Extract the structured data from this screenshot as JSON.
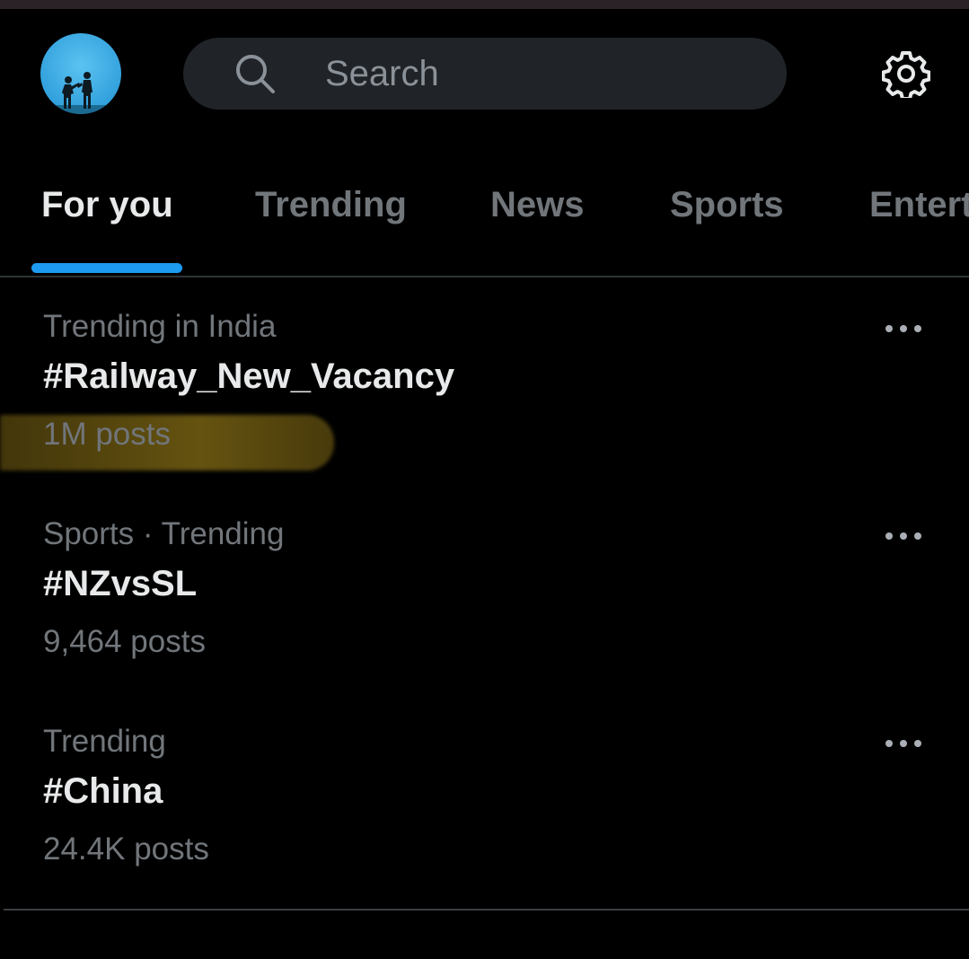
{
  "header": {
    "avatar_icon": "profile-avatar",
    "search": {
      "placeholder": "Search",
      "icon": "search-icon"
    },
    "settings_icon": "gear-icon"
  },
  "tabs": [
    {
      "label": "For you",
      "active": true
    },
    {
      "label": "Trending",
      "active": false
    },
    {
      "label": "News",
      "active": false
    },
    {
      "label": "Sports",
      "active": false
    },
    {
      "label": "Entert",
      "active": false
    }
  ],
  "trends": [
    {
      "context": "Trending in India",
      "topic": "#Railway_New_Vacancy",
      "count": "1M posts",
      "highlighted": true
    },
    {
      "context": "Sports · Trending",
      "topic": "#NZvsSL",
      "count": "9,464 posts",
      "highlighted": false
    },
    {
      "context": "Trending",
      "topic": "#China",
      "count": "24.4K posts",
      "highlighted": false
    }
  ],
  "colors": {
    "background": "#000000",
    "accent": "#1d9bf0",
    "primary_text": "#e7e9ea",
    "secondary_text": "#71767b",
    "highlight": "#8c7316"
  }
}
